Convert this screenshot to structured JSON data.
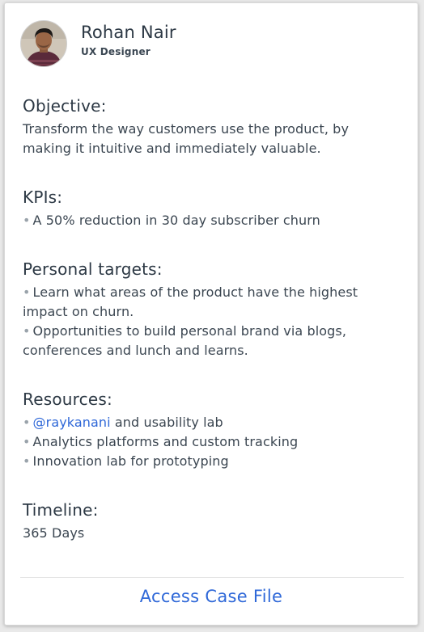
{
  "profile": {
    "name": "Rohan Nair",
    "role": "UX Designer"
  },
  "objective": {
    "heading": "Objective:",
    "text": "Transform the way customers use the product, by making it intuitive and immediately valuable."
  },
  "kpis": {
    "heading": "KPIs:",
    "items": [
      "A 50% reduction in 30 day subscriber churn"
    ]
  },
  "personal_targets": {
    "heading": "Personal targets:",
    "items": [
      "Learn what areas of the product have the highest impact on churn.",
      "Opportunities to build personal brand via blogs, conferences and lunch and learns."
    ]
  },
  "resources": {
    "heading": "Resources:",
    "mention": "@raykanani",
    "mention_suffix": " and usability lab",
    "items": [
      "Analytics platforms and custom tracking",
      "Innovation lab for prototyping"
    ]
  },
  "timeline": {
    "heading": "Timeline:",
    "value": "365 Days"
  },
  "footer": {
    "link_label": "Access Case File"
  },
  "colors": {
    "accent": "#2f68d8",
    "text": "#2c3844",
    "bullet": "#9aa3ab"
  },
  "bullet_char": "•"
}
